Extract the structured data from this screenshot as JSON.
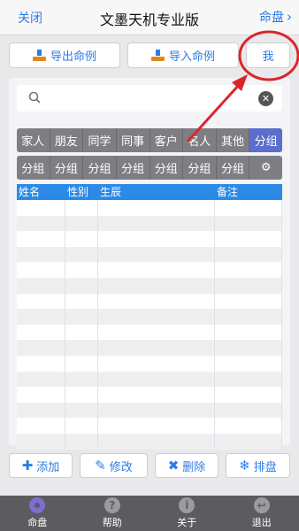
{
  "nav": {
    "close_label": "关闭",
    "title": "文墨天机专业版",
    "right_label": "命盘"
  },
  "top_buttons": {
    "export": "导出命例",
    "import": "导入命例",
    "me": "我"
  },
  "search": {
    "placeholder": ""
  },
  "categories": [
    "家人",
    "朋友",
    "同学",
    "同事",
    "客户",
    "名人",
    "其他",
    "分组"
  ],
  "groups": [
    "分组",
    "分组",
    "分组",
    "分组",
    "分组",
    "分组",
    "分组"
  ],
  "table": {
    "headers": [
      "姓名",
      "性别",
      "生辰",
      "备注"
    ]
  },
  "bottom_buttons": {
    "add": "添加",
    "edit": "修改",
    "delete": "删除",
    "sort": "排盘"
  },
  "tabs": [
    {
      "label": "命盘",
      "icon": "disc-icon"
    },
    {
      "label": "帮助",
      "icon": "help-icon"
    },
    {
      "label": "关于",
      "icon": "info-icon"
    },
    {
      "label": "退出",
      "icon": "exit-icon"
    }
  ],
  "colors": {
    "accent": "#2c7be5",
    "active_tab": "#5a6ecb",
    "header_bar": "#2b8ae6",
    "annotation": "#d9262c"
  }
}
